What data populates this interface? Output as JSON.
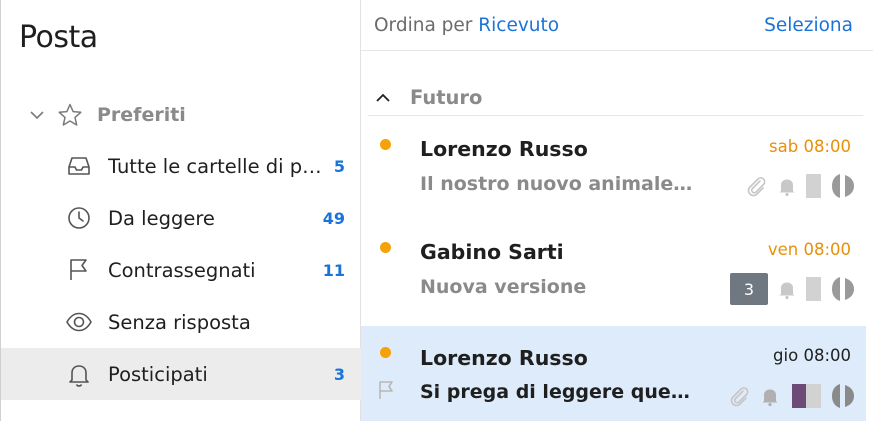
{
  "sidebar": {
    "title": "Posta",
    "favorites_label": "Preferiti",
    "items": [
      {
        "label": "Tutte le cartelle di posta",
        "count": "5",
        "icon": "inbox-tray-icon"
      },
      {
        "label": "Da leggere",
        "count": "49",
        "icon": "clock-icon"
      },
      {
        "label": "Contrassegnati",
        "count": "11",
        "icon": "flag-icon"
      },
      {
        "label": "Senza risposta",
        "count": "",
        "icon": "eye-icon"
      },
      {
        "label": "Posticipati",
        "count": "3",
        "icon": "bell-icon"
      }
    ]
  },
  "sortbar": {
    "label": "Ordina per",
    "value": "Ricevuto",
    "select_label": "Seleziona"
  },
  "group": {
    "label": "Futuro"
  },
  "messages": [
    {
      "sender": "Lorenzo Russo",
      "time": "sab 08:00",
      "subject": "Il nostro nuovo animale domestico",
      "badge": "",
      "unread": true
    },
    {
      "sender": "Gabino Sarti",
      "time": "ven 08:00",
      "subject": "Nuova versione",
      "badge": "3",
      "unread": true
    },
    {
      "sender": "Lorenzo Russo",
      "time": "gio 08:00",
      "subject": "Si prega di leggere questo messaggio",
      "badge": "",
      "unread": true
    }
  ],
  "colors": {
    "accent": "#1a73d9",
    "unread_dot": "#f5a10a",
    "selected_row": "#deebfa",
    "selected_nav": "#ececec",
    "tag_purple": "#6d4a78"
  }
}
